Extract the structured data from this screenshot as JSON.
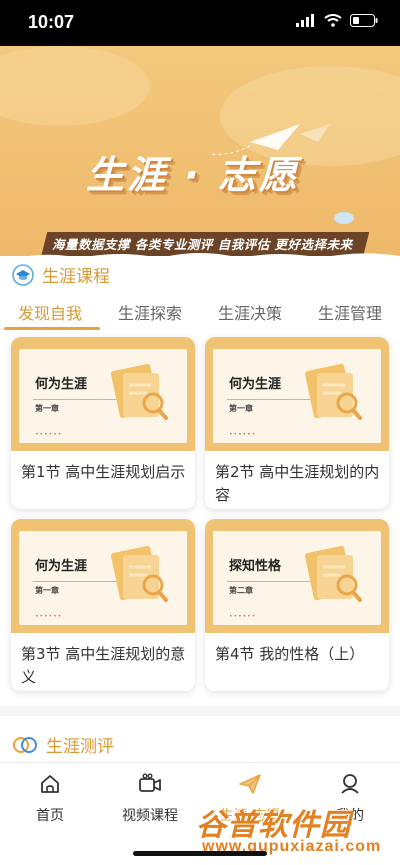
{
  "status_bar": {
    "time": "10:07"
  },
  "banner": {
    "title": "生涯 · 志愿",
    "subtitle": "海量数据支撑  各类专业测评  自我评估  更好选择未来"
  },
  "section_course": {
    "title": "生涯课程"
  },
  "tabs": [
    {
      "label": "发现自我",
      "active": true
    },
    {
      "label": "生涯探索",
      "active": false
    },
    {
      "label": "生涯决策",
      "active": false
    },
    {
      "label": "生涯管理",
      "active": false
    }
  ],
  "cards": [
    {
      "thumb_title": "何为生涯",
      "thumb_chapter": "第一章",
      "dots": "••••••",
      "caption": "第1节 高中生涯规划启示"
    },
    {
      "thumb_title": "何为生涯",
      "thumb_chapter": "第一章",
      "dots": "••••••",
      "caption": "第2节 高中生涯规划的内容"
    },
    {
      "thumb_title": "何为生涯",
      "thumb_chapter": "第一章",
      "dots": "••••••",
      "caption": "第3节 高中生涯规划的意义"
    },
    {
      "thumb_title": "探知性格",
      "thumb_chapter": "第二章",
      "dots": "••••••",
      "caption": "第4节 我的性格（上）"
    }
  ],
  "section_eval": {
    "title": "生涯测评"
  },
  "bottom_nav": [
    {
      "label": "首页",
      "icon": "home-icon"
    },
    {
      "label": "视频课程",
      "icon": "video-icon"
    },
    {
      "label": "生涯·志愿",
      "icon": "paper-plane-icon"
    },
    {
      "label": "我的",
      "icon": "user-icon"
    }
  ],
  "watermark": {
    "name": "谷普软件园",
    "url": "www.gupuxiazai.com"
  },
  "colors": {
    "accent": "#d99a33",
    "banner": "#f0c374",
    "strip": "#6b4428"
  }
}
